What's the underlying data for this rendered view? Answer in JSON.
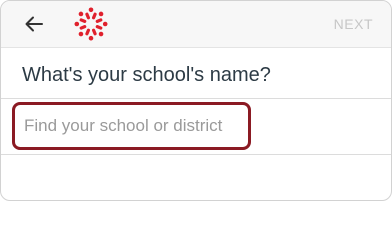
{
  "header": {
    "back_icon": "arrow-left-icon",
    "logo_icon": "canvas-logo-icon",
    "logo_color": "#e0212d",
    "next_label": "NEXT"
  },
  "main": {
    "question": "What's your school's name?",
    "search": {
      "value": "",
      "placeholder": "Find your school or district",
      "border_color": "#8b1a23"
    }
  }
}
